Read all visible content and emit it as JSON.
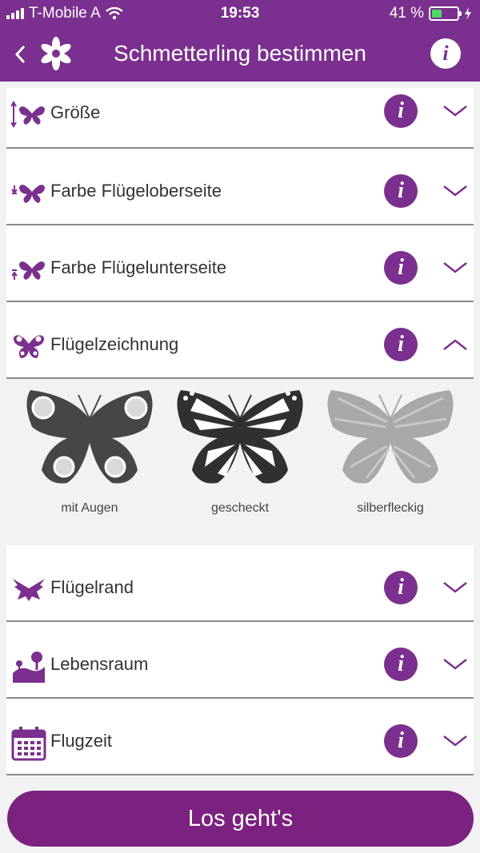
{
  "status_bar": {
    "carrier": "T-Mobile A",
    "time": "19:53",
    "battery_text": "41 %",
    "battery_level": 0.41
  },
  "nav": {
    "back_icon": "chevron-left-icon",
    "logo_icon": "flower-icon",
    "title": "Schmetterling bestimmen",
    "info_icon": "info-icon"
  },
  "colors": {
    "accent": "#7b2f8e",
    "button": "#7b2180",
    "divider": "#8a8a8a",
    "background": "#f2f2f2"
  },
  "filters": [
    {
      "label": "Größe",
      "icon": "butterfly-size-icon",
      "expanded": false
    },
    {
      "label": "Farbe Flügeloberseite",
      "icon": "butterfly-upperside-icon",
      "expanded": false
    },
    {
      "label": "Farbe Flügelunterseite",
      "icon": "butterfly-underside-icon",
      "expanded": false
    },
    {
      "label": "Flügelzeichnung",
      "icon": "butterfly-pattern-icon",
      "expanded": true
    },
    {
      "label": "Flügelrand",
      "icon": "butterfly-edge-icon",
      "expanded": false
    },
    {
      "label": "Lebensraum",
      "icon": "habitat-icon",
      "expanded": false
    },
    {
      "label": "Flugzeit",
      "icon": "calendar-icon",
      "expanded": false
    }
  ],
  "pattern_options": [
    {
      "label": "mit Augen",
      "icon": "butterfly-eyespots-icon"
    },
    {
      "label": "gescheckt",
      "icon": "butterfly-checkered-icon"
    },
    {
      "label": "silberfleckig",
      "icon": "butterfly-silver-spotted-icon"
    }
  ],
  "info_glyph": "i",
  "cta_label": "Los geht's"
}
